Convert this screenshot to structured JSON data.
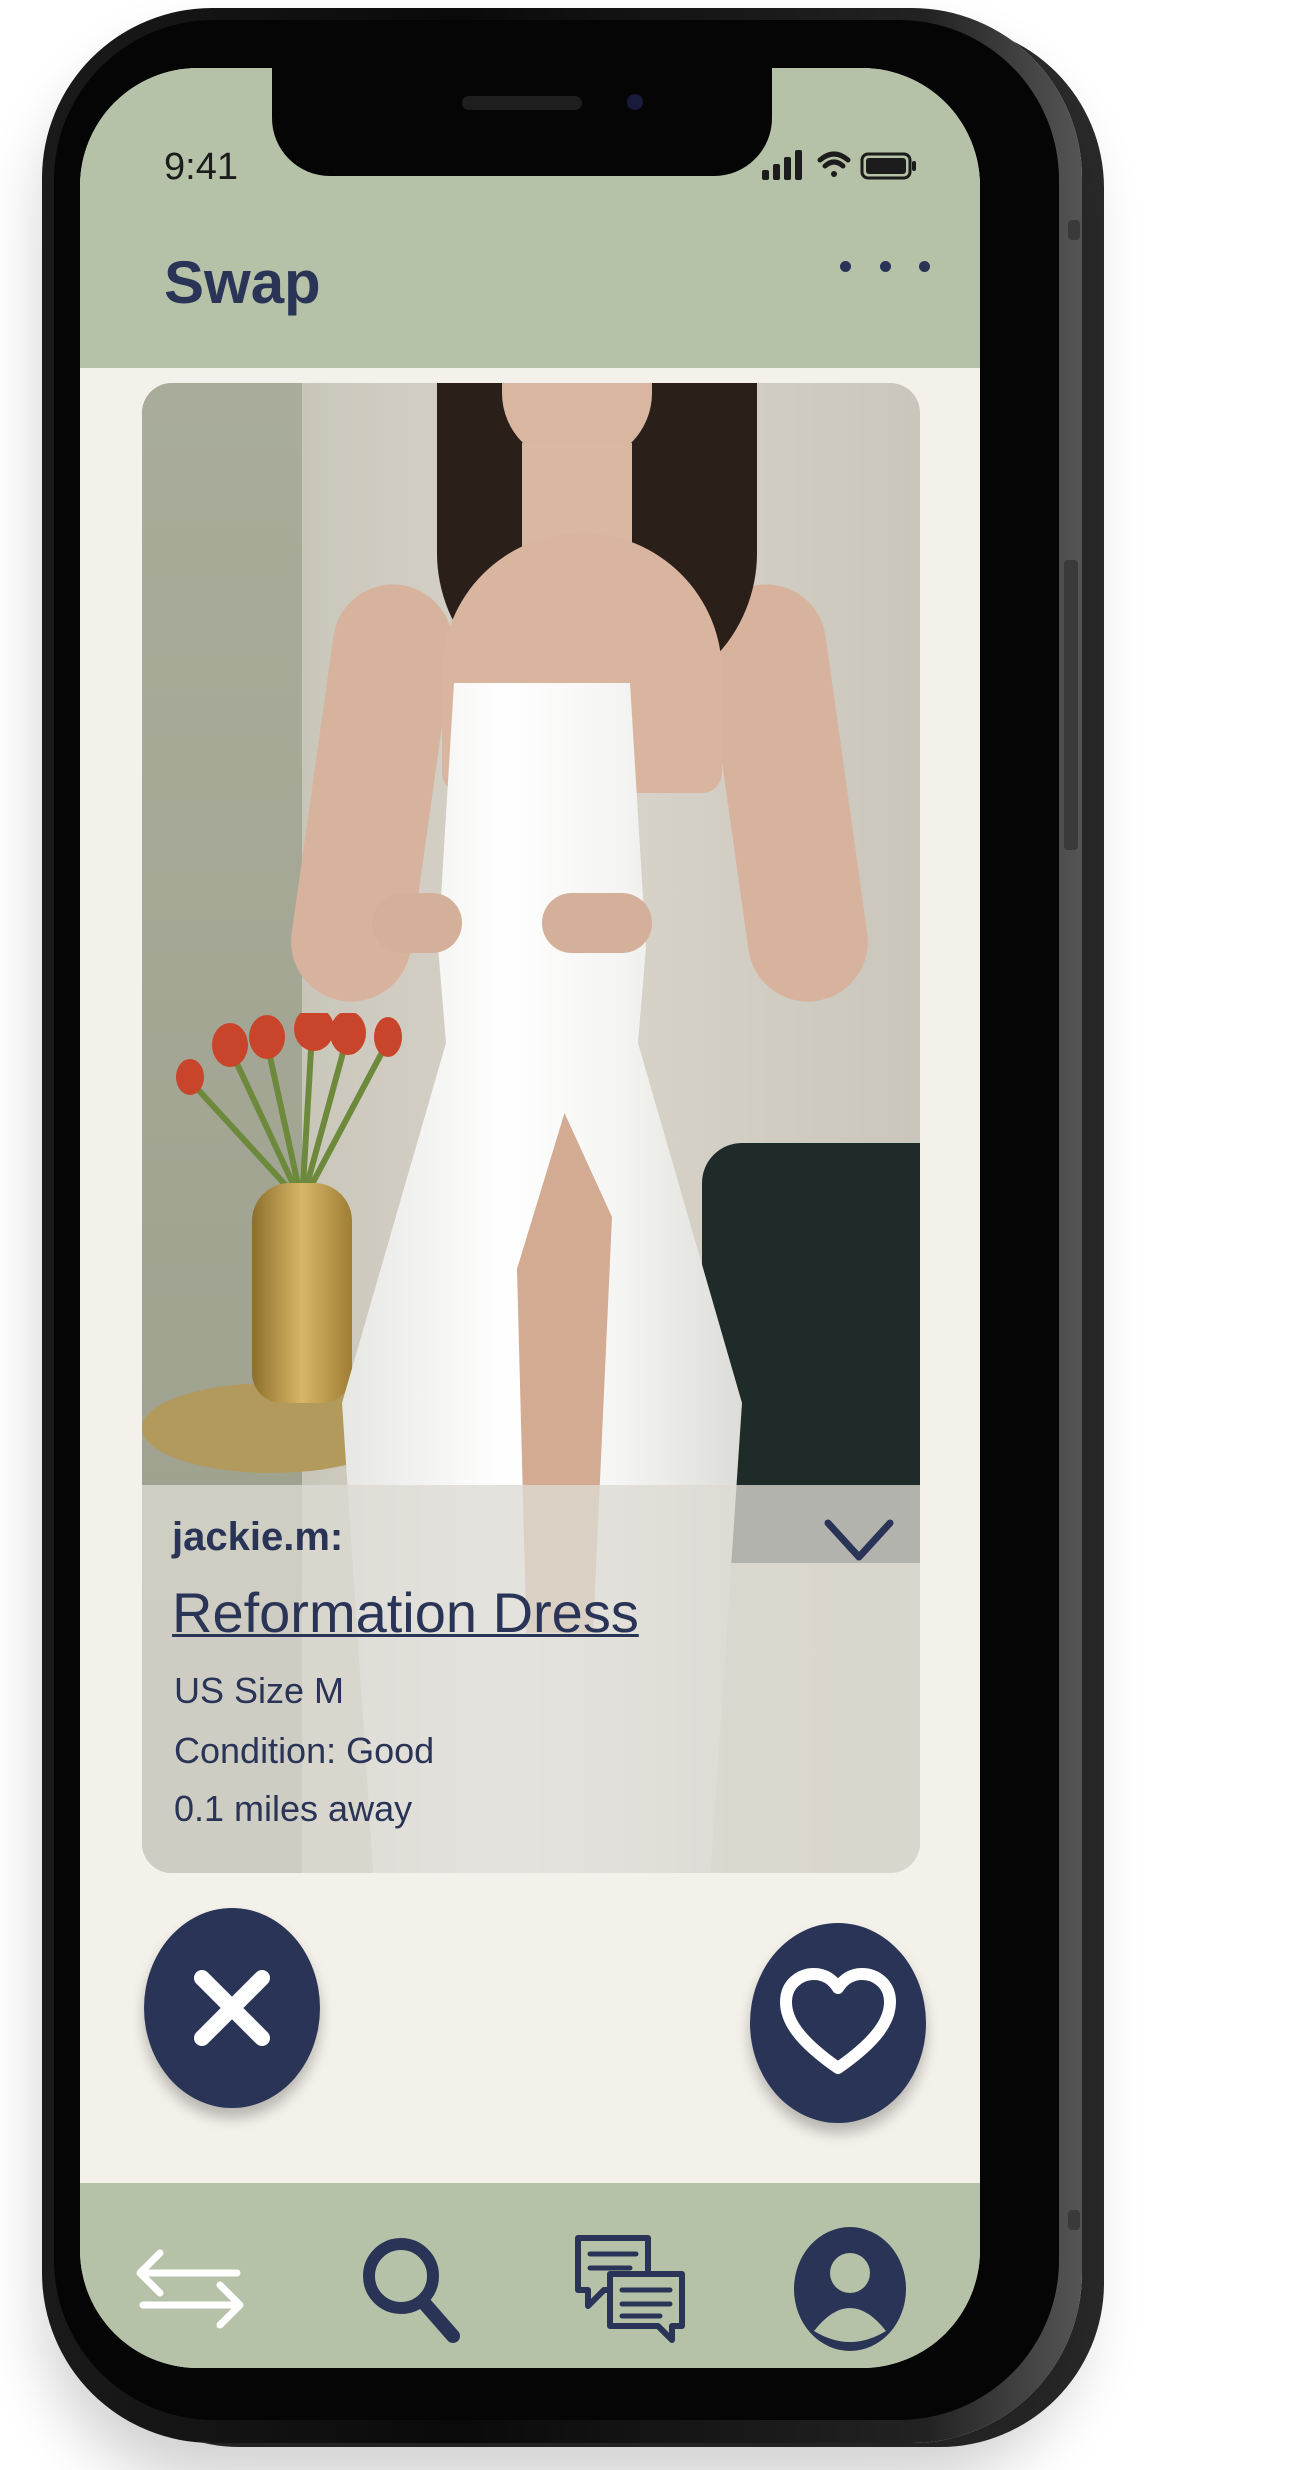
{
  "status_bar": {
    "time": "9:41"
  },
  "header": {
    "title": "Swap"
  },
  "listing": {
    "username": "jackie.m:",
    "title": "Reformation Dress",
    "size": "US Size M",
    "condition": "Condition: Good",
    "distance": "0.1 miles away"
  },
  "actions": {
    "reject_icon": "close-icon",
    "like_icon": "heart-icon"
  },
  "bottom_nav": [
    {
      "name": "swap",
      "icon": "swap-arrows-icon"
    },
    {
      "name": "search",
      "icon": "search-icon"
    },
    {
      "name": "messages",
      "icon": "chat-icon"
    },
    {
      "name": "profile",
      "icon": "profile-icon"
    }
  ],
  "colors": {
    "accent_green": "#b5c2a7",
    "navy": "#2a3457",
    "background": "#f4f1ea"
  }
}
